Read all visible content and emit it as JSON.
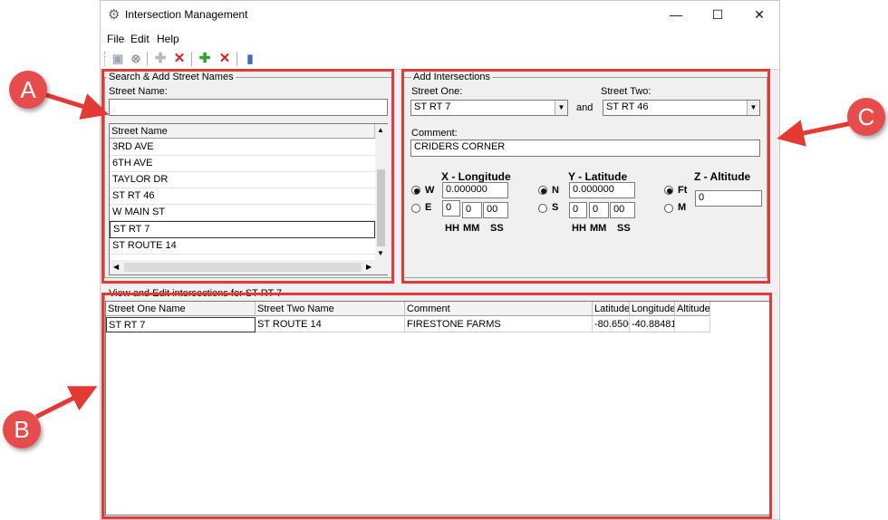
{
  "window": {
    "title": "Intersection Management",
    "minimize": "—",
    "maximize": "☐",
    "close": "✕"
  },
  "menu": [
    "File",
    "Edit",
    "Help"
  ],
  "search": {
    "group_label": "Search & Add Street Names",
    "field_label": "Street Name:",
    "value": "",
    "list_header": "Street Name",
    "items": [
      "3RD AVE",
      "6TH AVE",
      "TAYLOR DR",
      "ST RT 46",
      "W MAIN ST",
      "ST RT 7",
      "ST ROUTE 14"
    ],
    "selected_index": 5
  },
  "add": {
    "group_label": "Add Intersections",
    "street_one_label": "Street One:",
    "street_one_value": "ST RT 7",
    "and_label": "and",
    "street_two_label": "Street Two:",
    "street_two_value": "ST RT 46",
    "comment_label": "Comment:",
    "comment_value": "CRIDERS CORNER",
    "x": {
      "heading": "X - Longitude",
      "opt1": "W",
      "opt2": "E",
      "decimal": "0.000000",
      "hh": "0",
      "mm": "0",
      "ss": "00"
    },
    "y": {
      "heading": "Y - Latitude",
      "opt1": "N",
      "opt2": "S",
      "decimal": "0.000000",
      "hh": "0",
      "mm": "0",
      "ss": "00"
    },
    "z": {
      "heading": "Z - Altitude",
      "opt1": "Ft",
      "opt2": "M",
      "value": "0"
    },
    "dms_labels": {
      "hh": "HH",
      "mm": "MM",
      "ss": "SS"
    }
  },
  "view": {
    "group_label": "View and Edit intersections for ST RT 7",
    "columns": [
      "Street One Name",
      "Street Two Name",
      "Comment",
      "Latitude",
      "Longitude",
      "Altitude"
    ],
    "rows": [
      [
        "ST RT 7",
        "ST ROUTE 14",
        "FIRESTONE FARMS",
        "-80.6500",
        "-40.88481",
        ""
      ]
    ]
  },
  "callouts": {
    "a": "A",
    "b": "B",
    "c": "C"
  },
  "colors": {
    "annotation": "#e53935"
  }
}
